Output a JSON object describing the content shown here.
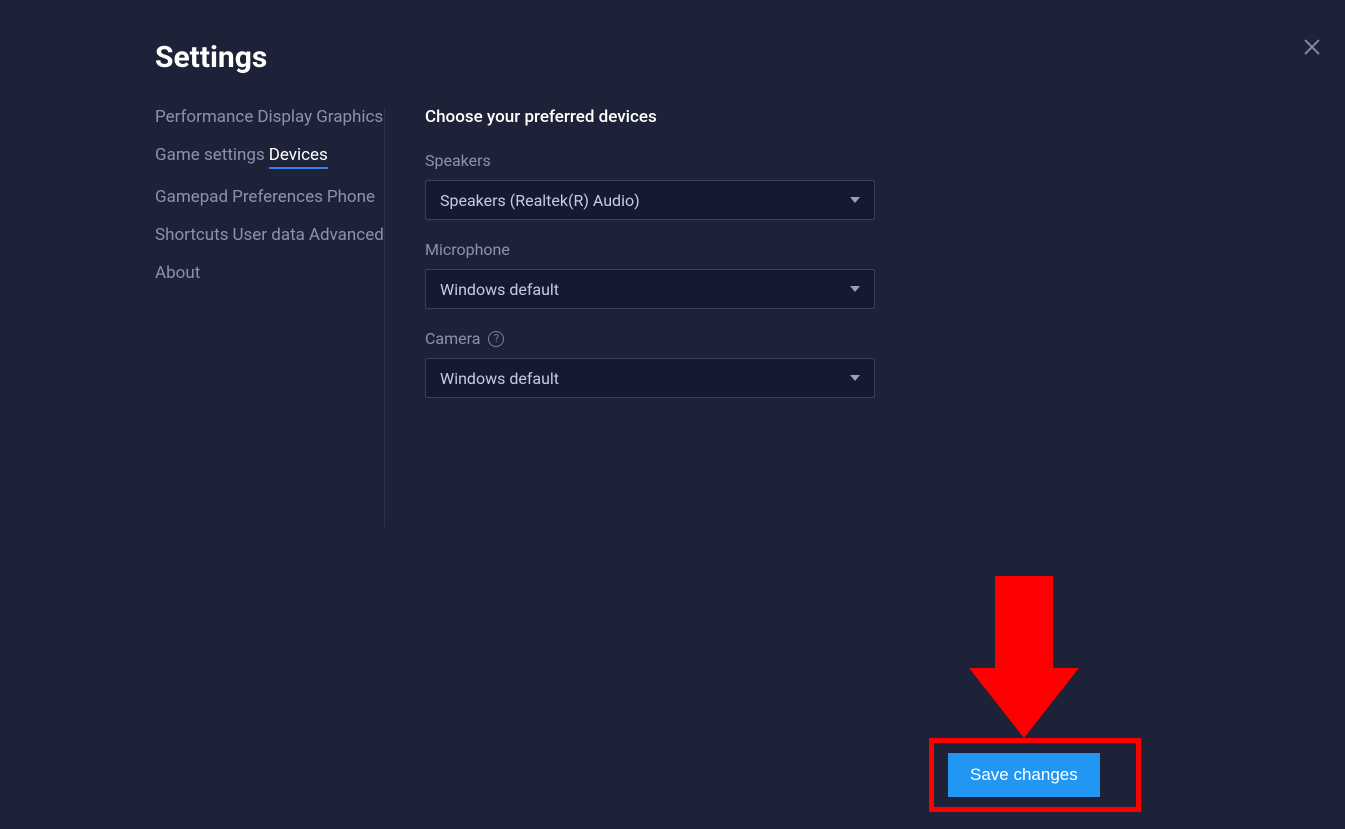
{
  "header": {
    "title": "Settings"
  },
  "sidebar": {
    "items": [
      "Performance",
      "Display",
      "Graphics",
      "Game settings",
      "Devices",
      "Gamepad",
      "Preferences",
      "Phone",
      "Shortcuts",
      "User data",
      "Advanced",
      "About"
    ],
    "active_index": 4
  },
  "content": {
    "section_title": "Choose your preferred devices",
    "speakers": {
      "label": "Speakers",
      "value": "Speakers (Realtek(R) Audio)"
    },
    "microphone": {
      "label": "Microphone",
      "value": "Windows default"
    },
    "camera": {
      "label": "Camera",
      "help_glyph": "?",
      "value": "Windows default"
    }
  },
  "footer": {
    "save_label": "Save changes"
  },
  "annotation": {
    "type": "highlight-arrow",
    "target": "save-button",
    "color": "#ff0000"
  }
}
